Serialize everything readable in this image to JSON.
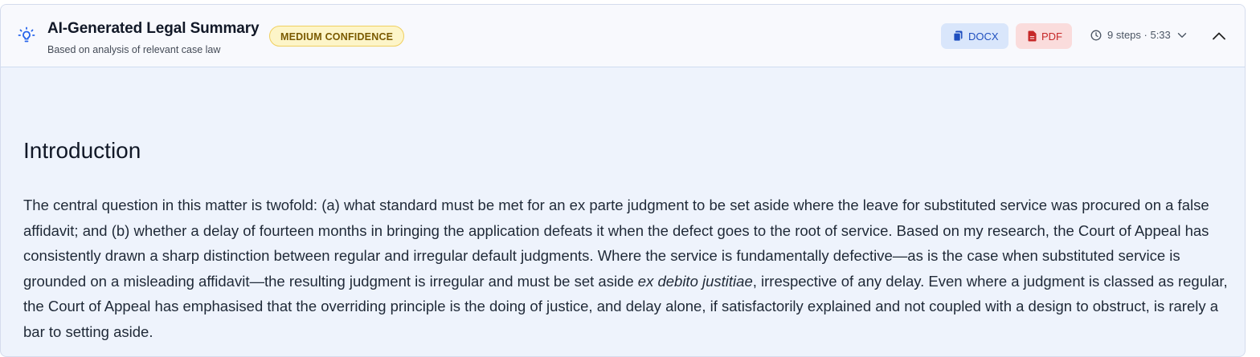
{
  "header": {
    "title": "AI-Generated Legal Summary",
    "subtitle": "Based on analysis of relevant case law",
    "confidence_badge": "MEDIUM CONFIDENCE",
    "docx_label": "DOCX",
    "pdf_label": "PDF",
    "steps_info": "9 steps · 5:33",
    "icons": [
      "lightbulb-icon",
      "document-icon",
      "pdf-file-icon",
      "clock-icon",
      "chevron-down-icon",
      "chevron-up-icon"
    ]
  },
  "content": {
    "heading": "Introduction",
    "paragraph_before_italic": "The central question in this matter is twofold: (a) what standard must be met for an ex parte judgment to be set aside where the leave for substituted service was procured on a false affidavit; and (b) whether a delay of fourteen months in bringing the application defeats it when the defect goes to the root of service. Based on my research, the Court of Appeal has consistently drawn a sharp distinction between regular and irregular default judgments. Where the service is fundamentally defective—as is the case when substituted service is grounded on a misleading affidavit—the resulting judgment is irregular and must be set aside ",
    "paragraph_italic": "ex debito justitiae",
    "paragraph_after_italic": ", irrespective of any delay. Even where a judgment is classed as regular, the Court of Appeal has emphasised that the overriding principle is the doing of justice, and delay alone, if satisfactorily explained and not coupled with a design to obstruct, is rarely a bar to setting aside."
  },
  "colors": {
    "accent_blue": "#1f4fbf",
    "badge_yellow": "#fdf5c8",
    "pdf_red": "#c62828",
    "content_bg": "#eef3fc"
  }
}
